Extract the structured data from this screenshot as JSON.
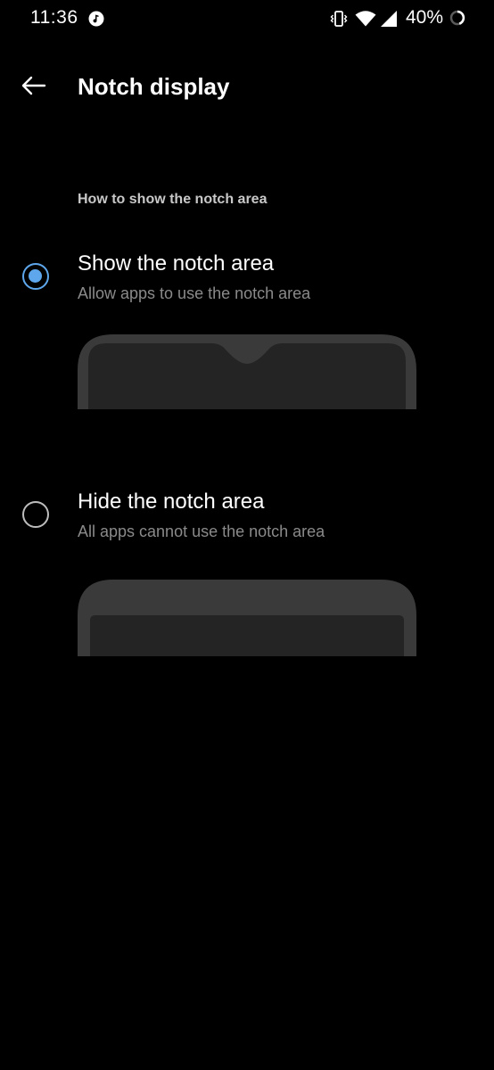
{
  "status_bar": {
    "time": "11:36",
    "battery": "40%",
    "icons": [
      "music-note-icon",
      "vibrate-icon",
      "wifi-icon",
      "cell-signal-icon",
      "battery-icon"
    ]
  },
  "toolbar": {
    "title": "Notch display",
    "back_icon": "back-arrow-icon"
  },
  "section": {
    "header": "How to show the notch area"
  },
  "options": [
    {
      "title": "Show the notch area",
      "subtitle": "Allow apps to use the notch area",
      "selected": true,
      "illustration": "phone-with-notch"
    },
    {
      "title": "Hide the notch area",
      "subtitle": "All apps cannot use the notch area",
      "selected": false,
      "illustration": "phone-without-notch"
    }
  ],
  "colors": {
    "background": "#000000",
    "accent": "#5ea7ec",
    "secondary_text": "#8a8a8a",
    "section_header": "#c8c8c8"
  }
}
